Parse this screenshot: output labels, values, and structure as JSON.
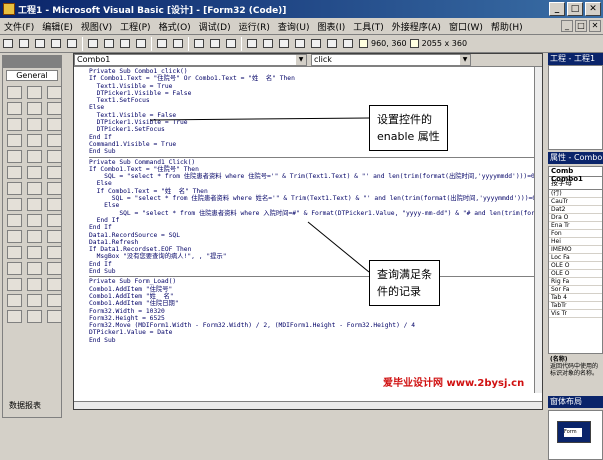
{
  "window": {
    "title": "工程1 - Microsoft Visual Basic [设计] - [Form32 (Code)]",
    "min": "_",
    "max": "□",
    "close": "✕"
  },
  "menu": [
    "文件(F)",
    "编辑(E)",
    "视图(V)",
    "工程(P)",
    "格式(O)",
    "调试(D)",
    "运行(R)",
    "查询(U)",
    "图表(I)",
    "工具(T)",
    "外接程序(A)",
    "窗口(W)",
    "帮助(H)"
  ],
  "toolbar": {
    "pos": "960, 360",
    "size": "2055 x 360"
  },
  "toolbox": {
    "tab": "General",
    "footer": "数据报表"
  },
  "editor": {
    "object_combo": "Combo1",
    "proc_combo": "click",
    "code": [
      "Private Sub Combo1_click()",
      "If Combo1.Text = \"住院号\" Or Combo1.Text = \"姓  名\" Then",
      "  Text1.Visible = True",
      "  DTPicker1.Visible = False",
      "  Text1.SetFocus",
      "Else",
      "  Text1.Visible = False",
      "  DTPicker1.Visible = True",
      "  DTPicker1.SetFocus",
      "End If",
      "Command1.Visible = True",
      "End Sub",
      "---",
      "Private Sub Command1_Click()",
      "If Combo1.Text = \"住院号\" Then",
      "    SQL = \"select * from 住院患者资料 where 住院号='\" & Trim(Text1.Text) & \"' and len(trim(format(出院时间,'yyyymmdd')))=0\"",
      "  Else",
      "  If Combo1.Text = \"姓  名\" Then",
      "      SQL = \"select * from 住院患者资料 where 姓名='\" & Trim(Text1.Text) & \"' and len(trim(format(出院时间,'yyyymmdd')))=0\"",
      "    Else",
      "        SQL = \"select * from 住院患者资料 where 入院时间=#\" & Format(DTPicker1.Value, \"yyyy-mm-dd\") & \"# and len(trim(format(出",
      "  End If",
      "End If",
      "Data1.RecordSource = SQL",
      "Data1.Refresh",
      "If Data1.Recordset.EOF Then",
      "  MsgBox \"没有您要查询的病人!\", , \"提示\"",
      "End If",
      "End Sub",
      "---",
      "Private Sub Form_Load()",
      "Combo1.AddItem \"住院号\"",
      "Combo1.AddItem \"姓  名\"",
      "Combo1.AddItem \"住院日期\"",
      "Form32.Width = 10320",
      "Form32.Height = 6525",
      "Form32.Move (MDIForm1.Width - Form32.Width) / 2, (MDIForm1.Height - Form32.Height) / 4",
      "DTPicker1.Value = Date",
      "End Sub"
    ]
  },
  "callouts": {
    "top": [
      "设置控件的",
      "enable 属性"
    ],
    "bottom": [
      "查询满足条",
      "件的记录"
    ]
  },
  "right_panel": {
    "project_title": "工程 - 工程1",
    "props_title": "属性 - Combo1",
    "object": "Comb Combo1",
    "tab": "按字母",
    "rows": [
      "(行)",
      "CauTr",
      "Dat2",
      "Dra O",
      "Ena Tr",
      "Fon",
      "Hei",
      "IMEMO",
      "Loc Fa",
      "OLE O",
      "OLE O",
      "Rig Fa",
      "Sor Fa",
      "Tab 4",
      "TabTr",
      "Vis Tr"
    ],
    "desc_title": "(名称)",
    "desc_text": "返回代码中使用的标识对象的名称。",
    "layout_title": "窗体布局",
    "layout_form": "Form"
  },
  "watermark": "爱毕业设计网  www.2bysj.cn",
  "colors": {
    "title_start": "#0a246a",
    "title_end": "#3a6ea5",
    "code": "#000066",
    "watermark": "#d01010"
  }
}
